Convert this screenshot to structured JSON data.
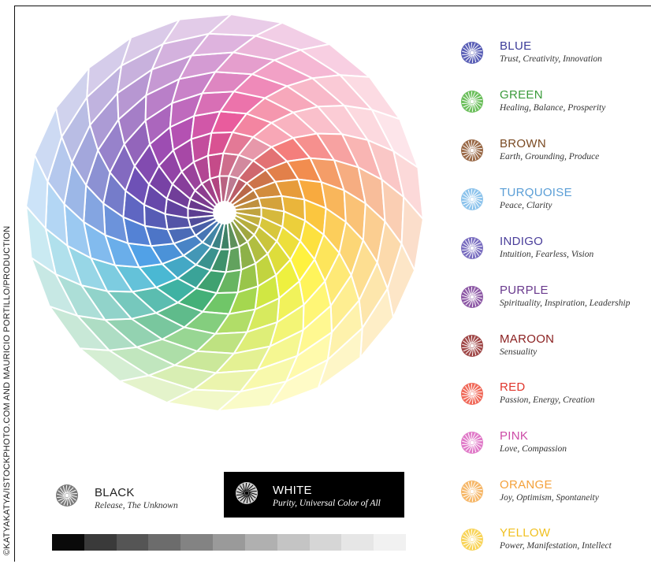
{
  "credit": "©KATYAKATYA/ISTOCKPHOTO.COM AND MAURICIO PORTILLO/PRODUCTION",
  "wheel": {
    "spokes": 24,
    "rings": 9,
    "spoke_colors": [
      "#f8a4b4",
      "#f47a78",
      "#f28a4a",
      "#f8a83a",
      "#fbc43a",
      "#fde03a",
      "#fff23a",
      "#eef03a",
      "#cfe63e",
      "#a2d64a",
      "#6cc464",
      "#3fae74",
      "#3ab0a0",
      "#45b6d2",
      "#4c9ee6",
      "#4f7ed4",
      "#5a62c0",
      "#6a4cb4",
      "#7e46ae",
      "#9a48b0",
      "#b24cb0",
      "#d052a6",
      "#e8579a",
      "#f3829e"
    ]
  },
  "legend": [
    {
      "name": "BLUE",
      "desc": "Trust, Creativity, Innovation",
      "color": "#3b3b99",
      "dot_color": "#5a5fb6"
    },
    {
      "name": "GREEN",
      "desc": "Healing, Balance, Prosperity",
      "color": "#3a9a3a",
      "dot_color": "#6cbf5c"
    },
    {
      "name": "BROWN",
      "desc": "Earth, Grounding, Produce",
      "color": "#7a4a22",
      "dot_color": "#9a6a48"
    },
    {
      "name": "TURQUOISE",
      "desc": "Peace, Clarity",
      "color": "#5a9ed6",
      "dot_color": "#8ec4ec"
    },
    {
      "name": "INDIGO",
      "desc": "Intuition, Fearless, Vision",
      "color": "#4a3e9a",
      "dot_color": "#7a6ec0"
    },
    {
      "name": "PURPLE",
      "desc": "Spirituality, Inspiration, Leadership",
      "color": "#6a3a8e",
      "dot_color": "#8e5aa6"
    },
    {
      "name": "MAROON",
      "desc": "Sensuality",
      "color": "#8a1f1f",
      "dot_color": "#a04848"
    },
    {
      "name": "RED",
      "desc": "Passion, Energy, Creation",
      "color": "#e0362c",
      "dot_color": "#f06a5a"
    },
    {
      "name": "PINK",
      "desc": "Love, Compassion",
      "color": "#cc4aa6",
      "dot_color": "#e07ac8"
    },
    {
      "name": "ORANGE",
      "desc": "Joy, Optimism, Spontaneity",
      "color": "#f4a13a",
      "dot_color": "#f6b86a"
    },
    {
      "name": "YELLOW",
      "desc": "Power, Manifestation, Intellect",
      "color": "#f0c020",
      "dot_color": "#f8d45a"
    }
  ],
  "black": {
    "name": "BLACK",
    "desc": "Release, The Unknown",
    "color": "#222222",
    "dot_color": "#7a7a7a"
  },
  "white": {
    "name": "WHITE",
    "desc": "Purity, Universal Color of All",
    "color": "#ffffff",
    "dot_color": "#cfcfcf"
  },
  "grayscale": [
    "#0a0a0a",
    "#3a3a3a",
    "#555555",
    "#6c6c6c",
    "#838383",
    "#9a9a9a",
    "#b0b0b0",
    "#c4c4c4",
    "#d6d6d6",
    "#e6e6e6",
    "#f1f1f1"
  ]
}
